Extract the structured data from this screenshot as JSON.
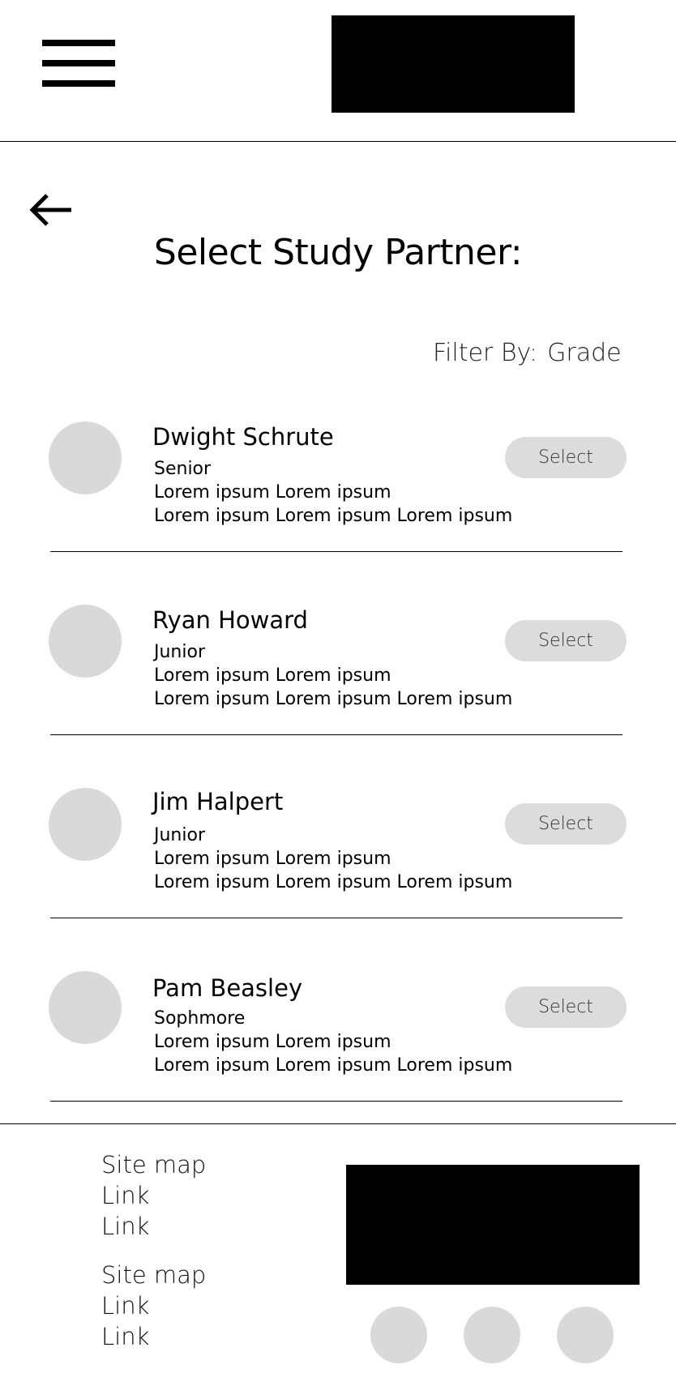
{
  "header": {
    "menu_icon": "hamburger-menu-icon",
    "logo": "logo-placeholder"
  },
  "page": {
    "back_icon": "back-arrow-icon",
    "title": "Select Study Partner:"
  },
  "filter": {
    "label": "Filter By:",
    "value": "Grade"
  },
  "partners": [
    {
      "name": "Dwight Schrute",
      "grade": "Senior",
      "line1": "Lorem ipsum Lorem ipsum",
      "line2": "Lorem ipsum Lorem ipsum Lorem ipsum",
      "button": "Select"
    },
    {
      "name": "Ryan Howard",
      "grade": "Junior",
      "line1": "Lorem ipsum Lorem ipsum",
      "line2": "Lorem ipsum Lorem ipsum Lorem ipsum",
      "button": "Select"
    },
    {
      "name": "Jim Halpert",
      "grade": "Junior",
      "line1": "Lorem ipsum Lorem ipsum",
      "line2": "Lorem ipsum Lorem ipsum Lorem ipsum",
      "button": "Select"
    },
    {
      "name": "Pam Beasley",
      "grade": "Sophmore",
      "line1": "Lorem ipsum Lorem ipsum",
      "line2": "Lorem ipsum Lorem ipsum Lorem ipsum",
      "button": "Select"
    }
  ],
  "footer": {
    "groups": [
      {
        "heading": "Site map",
        "links": [
          "Link",
          "Link"
        ]
      },
      {
        "heading": "Site map",
        "links": [
          "Link",
          "Link"
        ]
      }
    ],
    "social_icons": [
      "social-icon",
      "social-icon",
      "social-icon"
    ]
  },
  "colors": {
    "placeholder_gray": "#d9d9d9",
    "button_gray": "#dcdcdc",
    "block_black": "#000000"
  }
}
